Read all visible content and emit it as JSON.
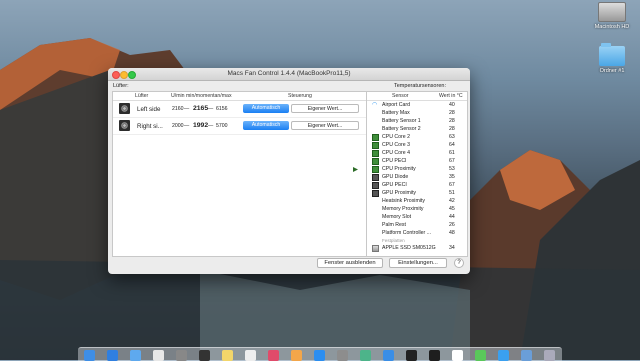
{
  "desktop": {
    "icons": [
      {
        "label": "Macintosh HD",
        "icon": "hard-drive-icon"
      },
      {
        "label": "Ordner #1",
        "icon": "folder-icon"
      }
    ]
  },
  "window": {
    "title": "Macs Fan Control 1.4.4 (MacBookPro11,5)",
    "fans_label": "Lüfter:",
    "sensors_label": "Temperatursensoren:",
    "fan_columns": [
      "Lüfter",
      "U/min min/momentan/max",
      "Steuerung"
    ],
    "fans": [
      {
        "name": "Left side",
        "min": "2160",
        "current": "2165",
        "max": "6156",
        "auto_label": "Automatisch",
        "custom_label": "Eigener Wert..."
      },
      {
        "name": "Right si...",
        "min": "2000",
        "current": "1992",
        "max": "5700",
        "auto_label": "Automatisch",
        "custom_label": "Eigener Wert..."
      }
    ],
    "sensor_columns": [
      "Sensor",
      "Wert in °C"
    ],
    "sensors": [
      {
        "name": "Airport Card",
        "value": "40",
        "icon": "wifi-icon"
      },
      {
        "name": "Battery Max",
        "value": "28",
        "icon": ""
      },
      {
        "name": "Battery Sensor 1",
        "value": "28",
        "icon": ""
      },
      {
        "name": "Battery Sensor 2",
        "value": "28",
        "icon": ""
      },
      {
        "name": "CPU Core 2",
        "value": "63",
        "icon": "cpu-chip-icon"
      },
      {
        "name": "CPU Core 3",
        "value": "64",
        "icon": "cpu-chip-icon"
      },
      {
        "name": "CPU Core 4",
        "value": "61",
        "icon": "cpu-chip-icon"
      },
      {
        "name": "CPU PECI",
        "value": "67",
        "icon": "cpu-chip-icon"
      },
      {
        "name": "CPU Proximity",
        "value": "53",
        "icon": "cpu-chip-icon"
      },
      {
        "name": "GPU Diode",
        "value": "35",
        "icon": "gpu-chip-icon"
      },
      {
        "name": "GPU PECI",
        "value": "67",
        "icon": "gpu-chip-icon"
      },
      {
        "name": "GPU Proximity",
        "value": "51",
        "icon": "gpu-chip-icon"
      },
      {
        "name": "Heatsink Proximity",
        "value": "42",
        "icon": ""
      },
      {
        "name": "Memory Proximity",
        "value": "45",
        "icon": ""
      },
      {
        "name": "Memory Slot",
        "value": "44",
        "icon": ""
      },
      {
        "name": "Palm Rest",
        "value": "26",
        "icon": ""
      },
      {
        "name": "Platform Controller ...",
        "value": "48",
        "icon": ""
      }
    ],
    "group_label": "Festplatten",
    "disks": [
      {
        "name": "APPLE SSD SM0512G",
        "value": "34",
        "icon": "disk-icon"
      }
    ],
    "hide_button": "Fenster ausblenden",
    "settings_button": "Einstellungen...",
    "help_button": "?"
  },
  "dock": {
    "icons": [
      "finder-icon",
      "safari-icon",
      "mail-icon",
      "photos-icon",
      "launchpad-icon",
      "clock-icon",
      "notes-icon",
      "reminders-icon",
      "itunes-icon",
      "ibooks-icon",
      "appstore-icon",
      "preferences-icon",
      "slack-icon",
      "xcode-icon",
      "terminal-icon",
      "activity-monitor-icon",
      "calendar-icon",
      "messages-icon",
      "airdrop-icon",
      "downloads-icon",
      "trash-icon"
    ]
  }
}
